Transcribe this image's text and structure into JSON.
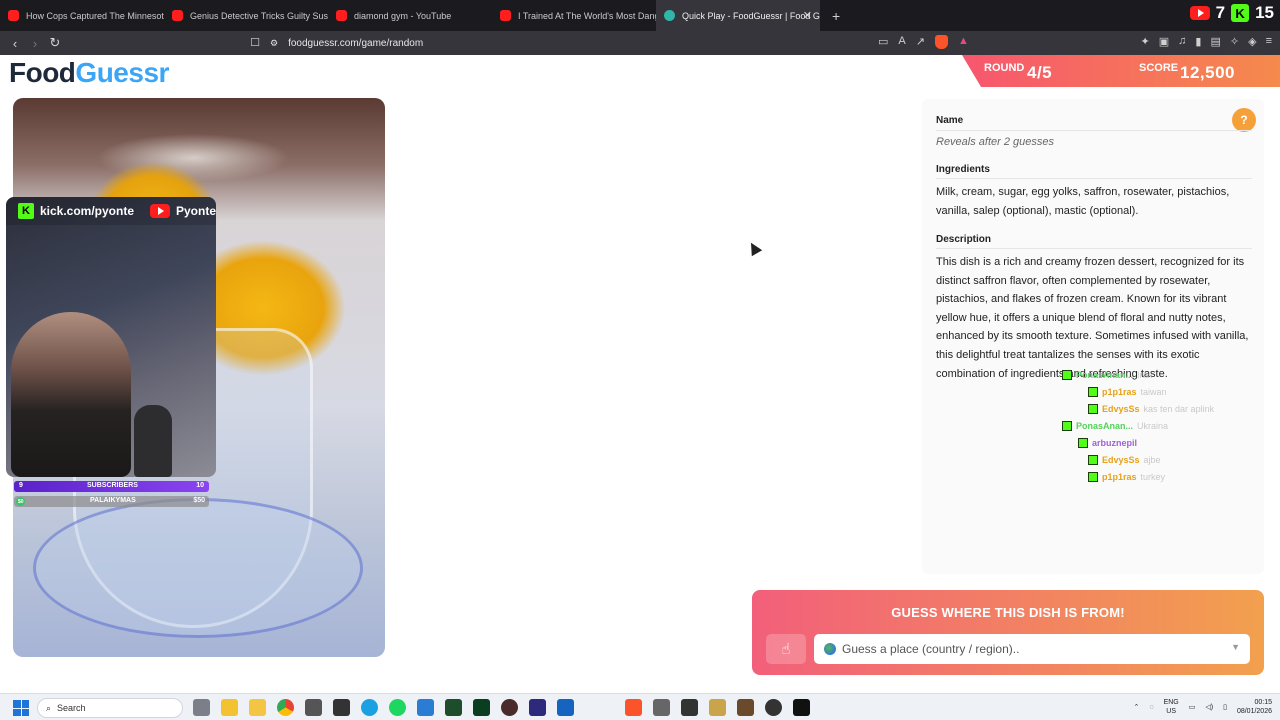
{
  "browser": {
    "tabs": [
      {
        "label": "How Cops Captured The Minnesota F",
        "type": "yt",
        "active": false
      },
      {
        "label": "Genius Detective Tricks Guilty Suspe",
        "type": "yt",
        "active": false
      },
      {
        "label": "diamond gym - YouTube",
        "type": "yt",
        "active": false
      },
      {
        "label": "I Trained At The World's Most Dange",
        "type": "yt",
        "active": false
      },
      {
        "label": "Quick Play - FoodGuessr | Food G",
        "type": "fg",
        "active": true
      }
    ],
    "new_tab": "+",
    "tab_close": "✕",
    "yt_count": "7",
    "kick_count": "15",
    "url": "foodguessr.com/game/random",
    "brave_badge": "4"
  },
  "game": {
    "logo_food": "Food",
    "logo_guessr": "Guessr",
    "round_label": "ROUND",
    "round_value": "4/5",
    "score_label": "SCORE",
    "score_value": "12,500"
  },
  "stream": {
    "kick_handle": "kick.com/pyonte",
    "yt_name": "Pyonte",
    "subs_left": "9",
    "subs_label": "SUBSCRIBERS",
    "subs_right": "10",
    "donate_label": "PALAIKYMAS",
    "donate_right": "$50",
    "donate_left": "$0"
  },
  "card": {
    "help": "?",
    "name_title": "Name",
    "name_value": "Reveals after 2 guesses",
    "ingredients_title": "Ingredients",
    "ingredients_value": "Milk, cream, sugar, egg yolks, saffron, rosewater, pistachios, vanilla, salep (optional), mastic (optional).",
    "description_title": "Description",
    "description_value": "This dish is a rich and creamy frozen dessert, recognized for its distinct saffron flavor, often complemented by rosewater, pistachios, and flakes of frozen cream. Known for its vibrant yellow hue, it offers a unique blend of floral and nutty notes, enhanced by its smooth texture. Sometimes infused with vanilla, this delightful treat tantalizes the senses with its exotic combination of ingredients and refreshing taste."
  },
  "chat": [
    {
      "name": "PonasAnan...",
      "msg": "Iran",
      "color": "#53d35a"
    },
    {
      "name": "p1p1ras",
      "msg": "taiwan",
      "color": "#e7a21a"
    },
    {
      "name": "EdvysSs",
      "msg": "kas ten dar aplink",
      "color": "#e7a21a"
    },
    {
      "name": "PonasAnan...",
      "msg": "Ukraina",
      "color": "#53d35a"
    },
    {
      "name": "arbuznepil",
      "msg": "",
      "color": "#a061d6"
    },
    {
      "name": "EdvysSs",
      "msg": "ajbe",
      "color": "#e7a21a"
    },
    {
      "name": "p1p1ras",
      "msg": "turkey",
      "color": "#e7a21a"
    }
  ],
  "guess": {
    "title": "GUESS WHERE THIS DISH IS FROM!",
    "placeholder": "Guess a place (country / region).."
  },
  "taskbar": {
    "search": "Search",
    "lang_top": "ENG",
    "lang_bottom": "US",
    "time": "00:15",
    "date": "08/01/2026"
  },
  "colors": {
    "accent_blue": "#3da5f5",
    "banner_start": "#f7566e",
    "banner_end": "#f58a4c",
    "kick_green": "#53fc18",
    "youtube_red": "#ff1e1e"
  }
}
